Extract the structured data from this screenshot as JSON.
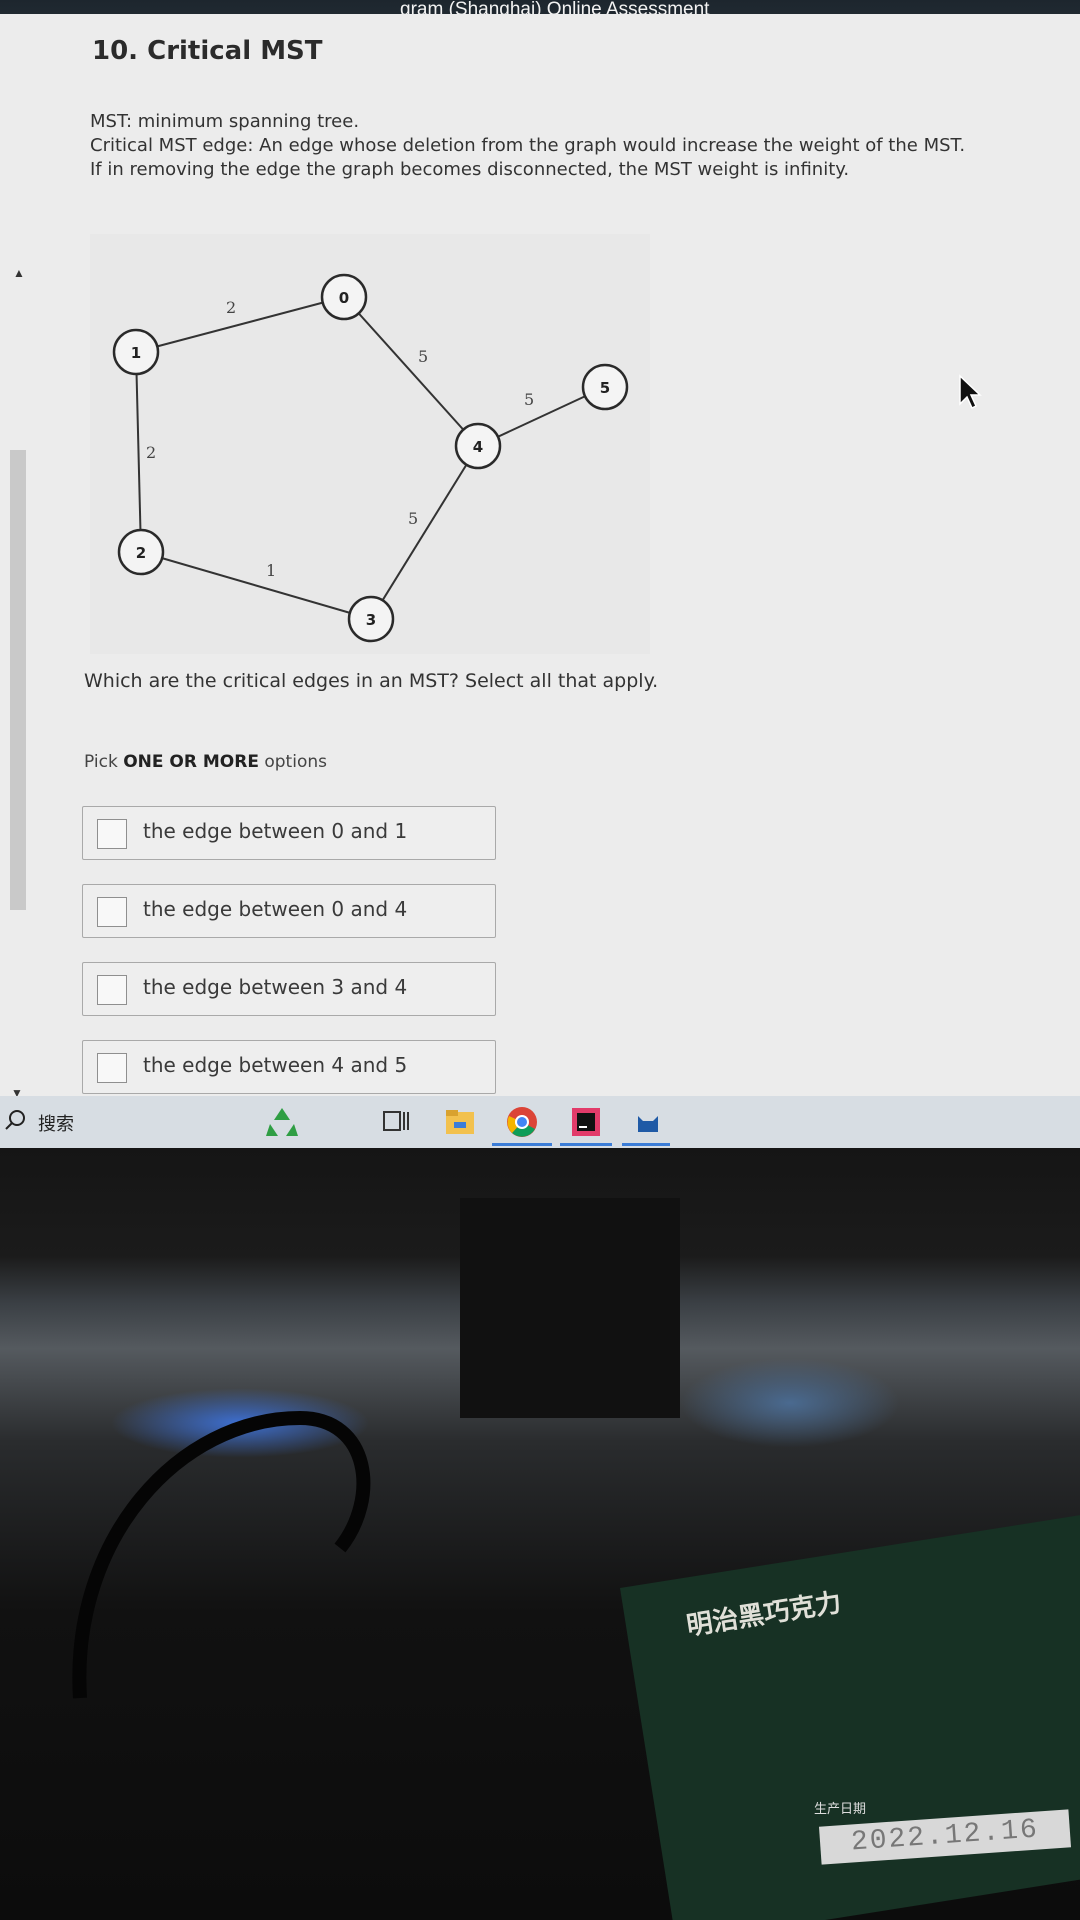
{
  "window": {
    "title": "gram (Shanghai) Online Assessment"
  },
  "question": {
    "title": "10. Critical MST",
    "description": [
      "MST: minimum spanning tree.",
      "Critical MST edge: An edge whose deletion from the graph would increase the weight of the MST.",
      "If in removing the edge the graph becomes disconnected, the MST weight is infinity."
    ],
    "prompt": "Which are the critical edges in an MST? Select all that apply.",
    "pick_prefix": "Pick ",
    "pick_emphasis": "ONE OR MORE",
    "pick_suffix": " options",
    "options": [
      "the edge between 0 and 1",
      "the edge between 0 and 4",
      "the edge between 3 and 4",
      "the edge between 4 and 5"
    ]
  },
  "graph": {
    "nodes": [
      "0",
      "1",
      "2",
      "3",
      "4",
      "5"
    ],
    "edges": [
      {
        "from": "1",
        "to": "0",
        "weight": "2"
      },
      {
        "from": "0",
        "to": "4",
        "weight": "5"
      },
      {
        "from": "4",
        "to": "5",
        "weight": "5"
      },
      {
        "from": "1",
        "to": "2",
        "weight": "2"
      },
      {
        "from": "2",
        "to": "3",
        "weight": "1"
      },
      {
        "from": "3",
        "to": "4",
        "weight": "5"
      }
    ]
  },
  "taskbar": {
    "search_label": "搜索",
    "apps": [
      "recycle-bin-icon",
      "task-view-icon",
      "file-explorer-icon",
      "chrome-icon",
      "jetbrains-icon",
      "cat-app-icon"
    ]
  },
  "package": {
    "brand": "明治黑巧克力",
    "date_label": "生产日期",
    "date": "2022.12.16"
  },
  "colors": {
    "page_bg": "#ececec",
    "taskbar_bg": "#d7dde3",
    "accent": "#3b7dd8",
    "package_green": "#173124"
  }
}
